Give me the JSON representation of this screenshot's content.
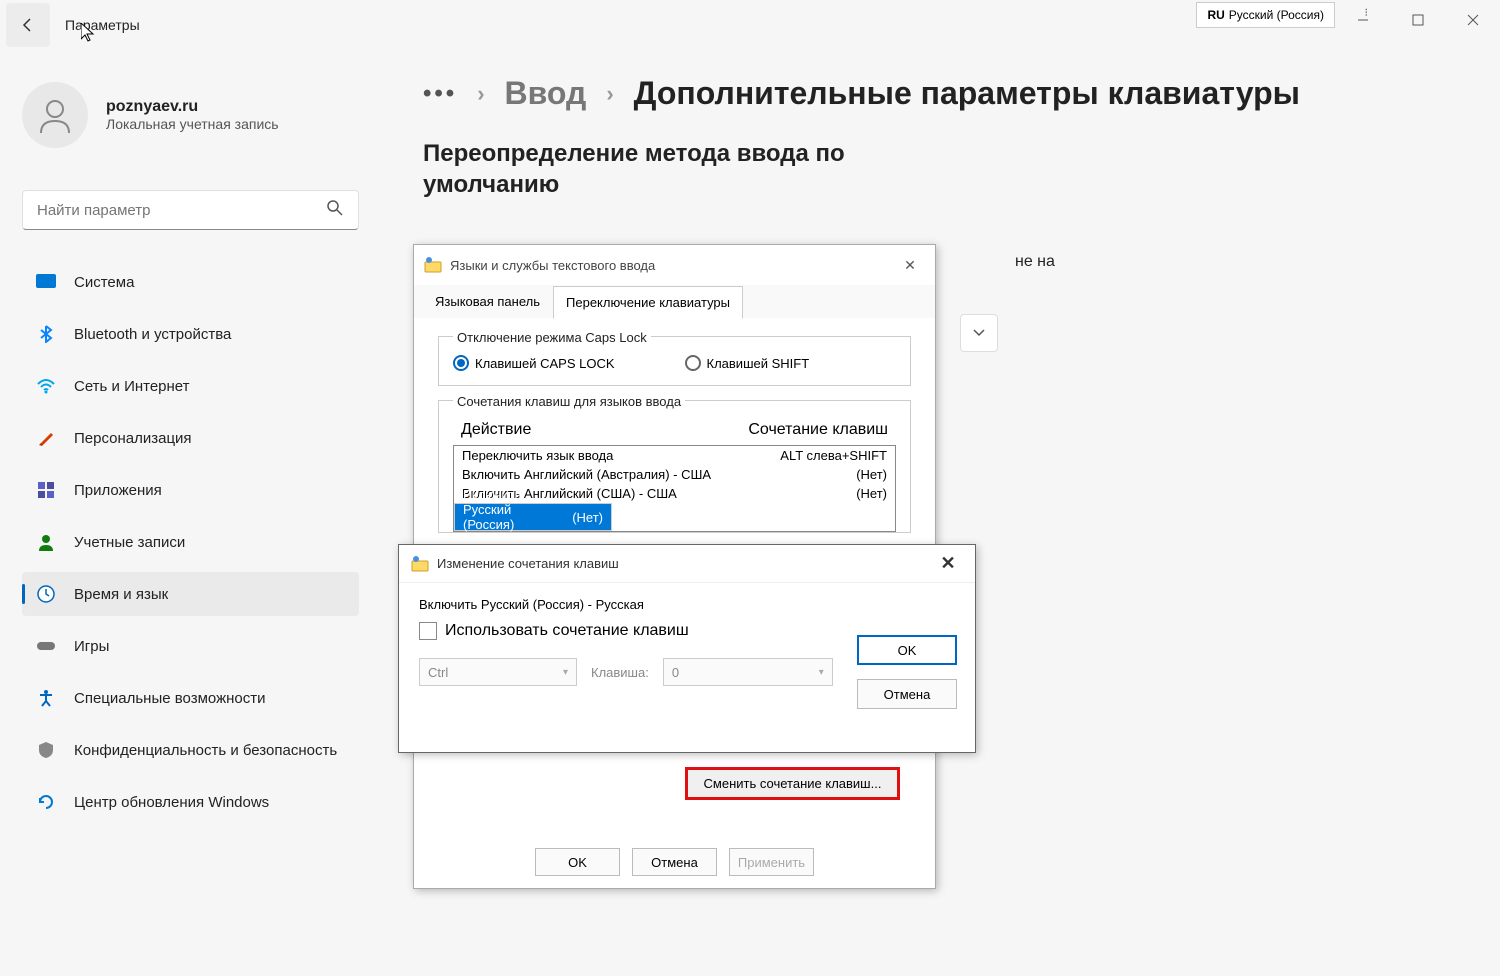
{
  "titlebar": {
    "app_title": "Параметры"
  },
  "lang_indicator": {
    "code": "RU",
    "name": "Русский (Россия)"
  },
  "user": {
    "name": "poznyaev.ru",
    "sub": "Локальная учетная запись"
  },
  "search": {
    "placeholder": "Найти параметр"
  },
  "sidebar": [
    {
      "label": "Система",
      "icon": "#0078d4"
    },
    {
      "label": "Bluetooth и устройства",
      "icon": "#0a84ff"
    },
    {
      "label": "Сеть и Интернет",
      "icon": "#00a4ef"
    },
    {
      "label": "Персонализация",
      "icon": "#d83b01"
    },
    {
      "label": "Приложения",
      "icon": "#5b5fc7"
    },
    {
      "label": "Учетные записи",
      "icon": "#107c10"
    },
    {
      "label": "Время и язык",
      "icon": "#ffb900"
    },
    {
      "label": "Игры",
      "icon": "#777"
    },
    {
      "label": "Специальные возможности",
      "icon": "#0067c0"
    },
    {
      "label": "Конфиденциальность и безопасность",
      "icon": "#888"
    },
    {
      "label": "Центр обновления Windows",
      "icon": "#0078d4"
    }
  ],
  "breadcrumb": {
    "link": "Ввод",
    "current": "Дополнительные параметры клавиатуры"
  },
  "bc_more": "•••",
  "section_title": "Переопределение метода ввода по умолчанию",
  "bg_text": "не на",
  "dlg1": {
    "title": "Языки и службы текстового ввода",
    "tabs": [
      "Языковая панель",
      "Переключение клавиатуры"
    ],
    "fs1_legend": "Отключение режима Caps Lock",
    "radio1": "Клавишей CAPS LOCK",
    "radio2": "Клавишей SHIFT",
    "fs2_legend": "Сочетания клавиш для языков ввода",
    "th1": "Действие",
    "th2": "Сочетание клавиш",
    "rows": [
      {
        "a": "Переключить язык ввода",
        "b": "ALT слева+SHIFT"
      },
      {
        "a": "Включить Английский (Австралия) - США",
        "b": "(Нет)"
      },
      {
        "a": "Включить Английский (США) - США",
        "b": "(Нет)"
      },
      {
        "a": "Включить Русский (Россия) - Русская",
        "b": "(Нет)"
      }
    ],
    "change_btn": "Сменить сочетание клавиш...",
    "ok": "OK",
    "cancel": "Отмена",
    "apply": "Применить"
  },
  "dlg2": {
    "title": "Изменение сочетания клавиш",
    "line1": "Включить Русский (Россия) - Русская",
    "check_label": "Использовать сочетание клавиш",
    "sel1": "Ctrl",
    "kv_label": "Клавиша:",
    "sel2": "0",
    "ok": "OK",
    "cancel": "Отмена"
  }
}
